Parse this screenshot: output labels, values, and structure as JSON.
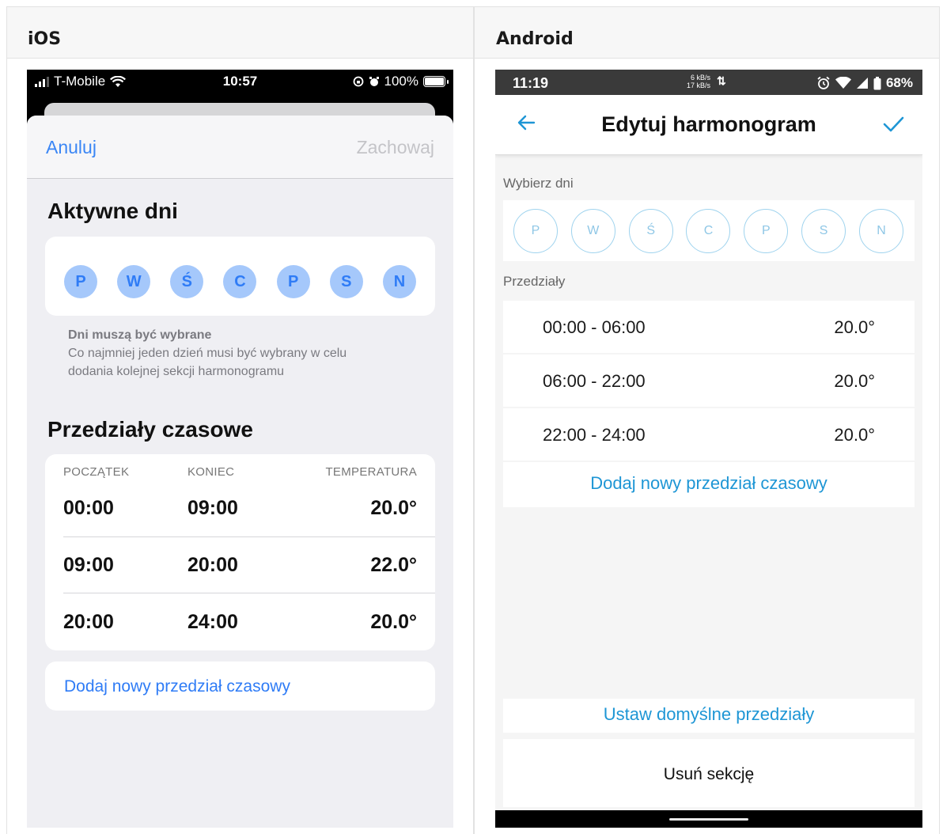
{
  "columns": {
    "ios": "iOS",
    "android": "Android"
  },
  "ios": {
    "status": {
      "carrier": "T-Mobile",
      "time": "10:57",
      "battery": "100%"
    },
    "nav": {
      "cancel": "Anuluj",
      "save": "Zachowaj"
    },
    "active_days_title": "Aktywne dni",
    "days": [
      "P",
      "W",
      "Ś",
      "C",
      "P",
      "S",
      "N"
    ],
    "note_title": "Dni muszą być wybrane",
    "note_line1": "Co najmniej jeden dzień musi być wybrany w celu",
    "note_line2": "dodania kolejnej sekcji harmonogramu",
    "intervals_title": "Przedziały czasowe",
    "headers": {
      "start": "POCZĄTEK",
      "end": "KONIEC",
      "temp": "TEMPERATURA"
    },
    "rows": [
      {
        "start": "00:00",
        "end": "09:00",
        "temp": "20.0°"
      },
      {
        "start": "09:00",
        "end": "20:00",
        "temp": "22.0°"
      },
      {
        "start": "20:00",
        "end": "24:00",
        "temp": "20.0°"
      }
    ],
    "add_interval": "Dodaj nowy przedział czasowy",
    "colors": {
      "accent": "#2f7cf6",
      "day_fill": "#a5c8fb"
    }
  },
  "android": {
    "status": {
      "time": "11:19",
      "speed_up": "6 kB/s",
      "speed_down": "17 kB/s",
      "battery": "68%"
    },
    "title": "Edytuj harmonogram",
    "select_days_label": "Wybierz dni",
    "days": [
      "P",
      "W",
      "Ś",
      "C",
      "P",
      "S",
      "N"
    ],
    "intervals_label": "Przedziały",
    "rows": [
      {
        "range": "00:00 - 06:00",
        "temp": "20.0°"
      },
      {
        "range": "06:00 - 22:00",
        "temp": "20.0°"
      },
      {
        "range": "22:00 - 24:00",
        "temp": "20.0°"
      }
    ],
    "add_interval": "Dodaj nowy przedział czasowy",
    "set_defaults": "Ustaw domyślne przedziały",
    "delete_section": "Usuń sekcję",
    "colors": {
      "accent": "#1e96d5"
    }
  }
}
